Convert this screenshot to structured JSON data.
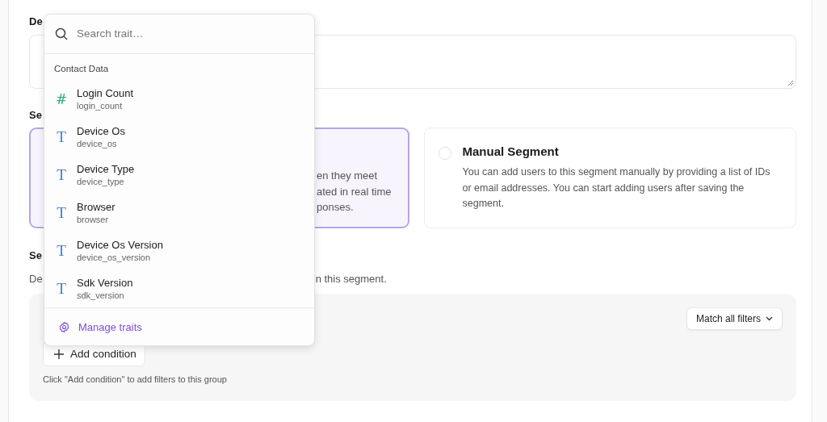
{
  "description": {
    "label": "De"
  },
  "segment_type": {
    "label": "Se",
    "options": [
      {
        "kind": "dynamic",
        "selected": true,
        "description_lines": [
          "en they meet",
          "ated in real time",
          "ponses."
        ]
      },
      {
        "kind": "manual",
        "selected": false,
        "title": "Manual Segment",
        "description": "You can add users to this segment manually by providing a list of IDs or email addresses. You can start adding users after saving the segment."
      }
    ]
  },
  "filters": {
    "label": "Se",
    "description_start": "De",
    "description_end": "n this segment.",
    "match_button": "Match all filters",
    "add_condition": "Add condition",
    "hint": "Click \"Add condition\" to add filters to this group"
  },
  "trait_menu": {
    "placeholder": "Search trait…",
    "group": "Contact Data",
    "items": [
      {
        "kind": "number",
        "icon": "#",
        "name": "Login Count",
        "key": "login_count"
      },
      {
        "kind": "text",
        "icon": "T",
        "name": "Device Os",
        "key": "device_os"
      },
      {
        "kind": "text",
        "icon": "T",
        "name": "Device Type",
        "key": "device_type"
      },
      {
        "kind": "text",
        "icon": "T",
        "name": "Browser",
        "key": "browser"
      },
      {
        "kind": "text",
        "icon": "T",
        "name": "Device Os Version",
        "key": "device_os_version"
      },
      {
        "kind": "text",
        "icon": "T",
        "name": "Sdk Version",
        "key": "sdk_version"
      }
    ],
    "footer": "Manage traits"
  }
}
